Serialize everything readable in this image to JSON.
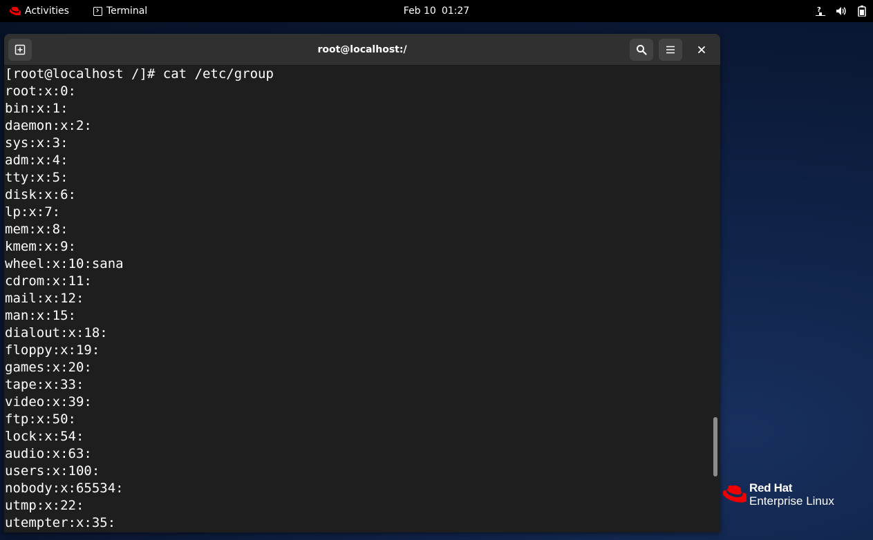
{
  "topbar": {
    "activities_label": "Activities",
    "app_label": "Terminal",
    "clock": {
      "date": "Feb 10",
      "time": "01:27"
    },
    "tray_icons": [
      "network-unknown-icon",
      "volume-icon",
      "battery-icon"
    ]
  },
  "window": {
    "title": "root@localhost:/",
    "buttons": [
      "new-tab-icon",
      "search-icon",
      "hamburger-menu-icon",
      "close-icon"
    ]
  },
  "terminal": {
    "lines": [
      "[root@localhost /]# cat /etc/group",
      "root:x:0:",
      "bin:x:1:",
      "daemon:x:2:",
      "sys:x:3:",
      "adm:x:4:",
      "tty:x:5:",
      "disk:x:6:",
      "lp:x:7:",
      "mem:x:8:",
      "kmem:x:9:",
      "wheel:x:10:sana",
      "cdrom:x:11:",
      "mail:x:12:",
      "man:x:15:",
      "dialout:x:18:",
      "floppy:x:19:",
      "games:x:20:",
      "tape:x:33:",
      "video:x:39:",
      "ftp:x:50:",
      "lock:x:54:",
      "audio:x:63:",
      "users:x:100:",
      "nobody:x:65534:",
      "utmp:x:22:",
      "utempter:x:35:"
    ]
  },
  "branding": {
    "line1": "Red Hat",
    "line2": "Enterprise Linux",
    "color": "#ee0000"
  },
  "colors": {
    "terminal_bg": "#1e1e1e",
    "headerbar_bg": "#303030",
    "topbar_bg": "#000000"
  }
}
